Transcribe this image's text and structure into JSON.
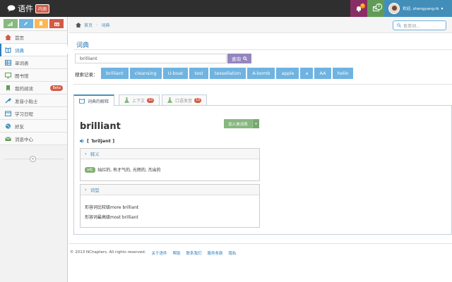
{
  "topbar": {
    "brand": "语件",
    "beta": "内测",
    "notifications_count": "0",
    "messages_count": "0",
    "user_name": "欢迎, zhengyang-lk"
  },
  "sidebar": {
    "shortcut_icons": [
      "signal-icon",
      "pencil-icon",
      "bookmark-icon",
      "gift-icon"
    ],
    "items": [
      {
        "label": "首页",
        "icon": "home-icon"
      },
      {
        "label": "词典",
        "icon": "book-icon"
      },
      {
        "label": "单词表",
        "icon": "table-icon"
      },
      {
        "label": "图书馆",
        "icon": "desktop-icon"
      },
      {
        "label": "我的阅读",
        "icon": "bookmark-icon",
        "badge": "Beta"
      },
      {
        "label": "发音小贴士",
        "icon": "wrench-icon"
      },
      {
        "label": "学习日程",
        "icon": "calendar-icon"
      },
      {
        "label": "好友",
        "icon": "globe-icon"
      },
      {
        "label": "消息中心",
        "icon": "envelope-icon"
      }
    ],
    "collapse_glyph": "«"
  },
  "breadcrumb": {
    "home": "首页",
    "current": "词典"
  },
  "nav_search": {
    "placeholder": "查单词..."
  },
  "main": {
    "title": "词典",
    "search_value": "brilliant",
    "search_button": "查询",
    "history_label": "搜索记录：",
    "history": [
      "brilliant",
      "cleansing",
      "U-boat",
      "test",
      "tessellation",
      "A-bomb",
      "apple",
      "a",
      "AA",
      "hello"
    ]
  },
  "tabs": [
    {
      "label": "词典的解释",
      "badge": ""
    },
    {
      "label": "上下文",
      "badge": "10"
    },
    {
      "label": "口语发音",
      "badge": "10"
    }
  ],
  "entry": {
    "word": "brilliant",
    "add_button": "加入单词表",
    "phonetic": "[ ˈbriljənt ]",
    "definition_header": "释义",
    "pos": "adj.",
    "definition": "灿烂的, 有才气的, 光辉的, 杰出的",
    "forms_header": "词型",
    "comparative": "形容词比较级more brilliant",
    "superlative": "形容词最高级most brilliant"
  },
  "footer": {
    "copyright": "© 2013 NChapters. All rights reserved.",
    "links": [
      "关于语件",
      "帮助",
      "联系我们",
      "服务条款",
      "隐私"
    ]
  },
  "colors": {
    "topbar": "#2f2f2f",
    "accent_blue": "#438eb9",
    "tag_blue": "#6fb3e0",
    "search_purple": "#9585bf",
    "success_green": "#87b87f",
    "danger_red": "#d15b47"
  }
}
